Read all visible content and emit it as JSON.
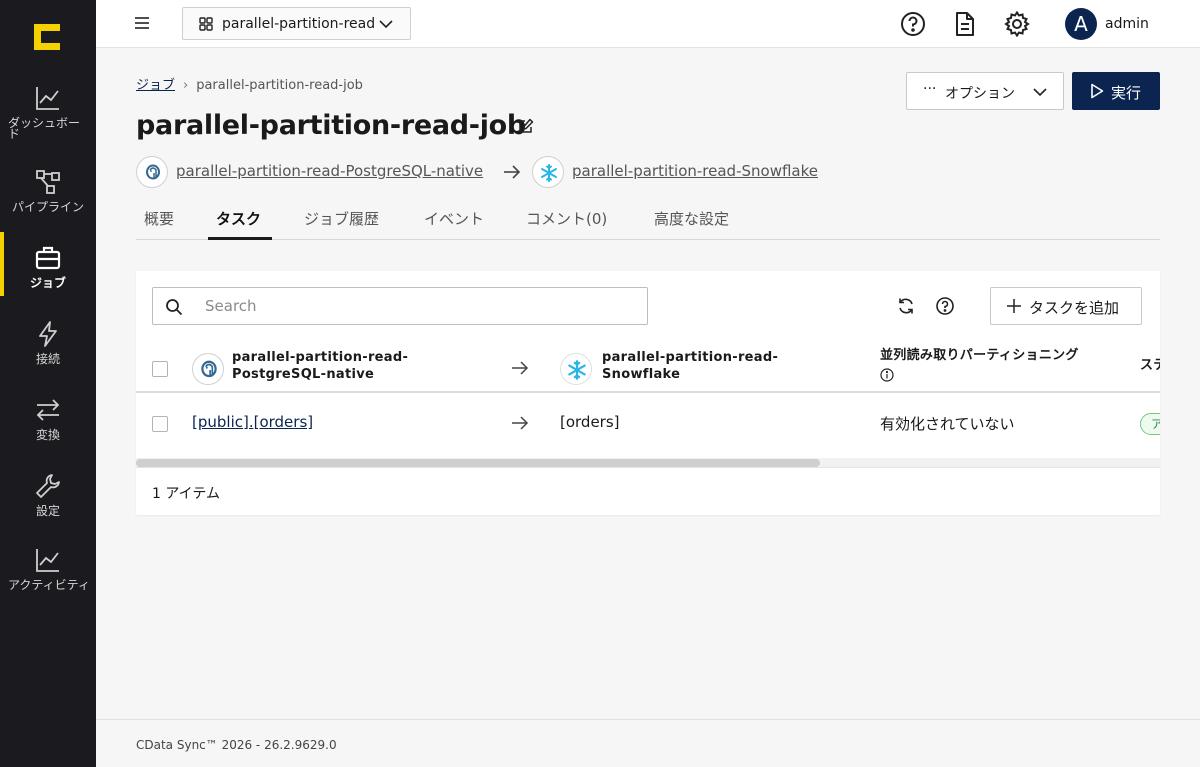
{
  "sidebar": {
    "items": [
      {
        "label": "ダッシュボード",
        "icon": "chart-line-icon"
      },
      {
        "label": "パイプライン",
        "icon": "pipeline-icon"
      },
      {
        "label": "ジョブ",
        "icon": "briefcase-icon"
      },
      {
        "label": "接続",
        "icon": "lightning-icon"
      },
      {
        "label": "変換",
        "icon": "transform-arrows-icon"
      },
      {
        "label": "設定",
        "icon": "wrench-icon"
      },
      {
        "label": "アクティビティ",
        "icon": "activity-chart-icon"
      }
    ],
    "active": "ジョブ"
  },
  "topbar": {
    "workspace": "parallel-partition-read",
    "user": "admin",
    "avatar_letter": "A"
  },
  "breadcrumb": {
    "parent": "ジョブ",
    "current": "parallel-partition-read-job"
  },
  "header": {
    "title": "parallel-partition-read-job",
    "options_label": "オプション",
    "run_label": "実行",
    "source": "parallel-partition-read-PostgreSQL-native",
    "destination": "parallel-partition-read-Snowflake"
  },
  "tabs": [
    "概要",
    "タスク",
    "ジョブ履歴",
    "イベント",
    "コメント(0)",
    "高度な設定"
  ],
  "active_tab": "タスク",
  "tasks": {
    "search_placeholder": "Search",
    "add_label": "タスクを追加",
    "columns": {
      "source": "parallel-partition-read-PostgreSQL-native",
      "destination": "parallel-partition-read-Snowflake",
      "partition": "並列読み取りパーティショニング",
      "status_partial": "ステ"
    },
    "rows": [
      {
        "source": "[public].[orders]",
        "destination": "[orders]",
        "partition": "有効化されていない",
        "status_partial": "ア"
      }
    ],
    "count_label": "1 アイテム"
  },
  "footer": {
    "version": "CData Sync™ 2026 - 26.2.9629.0"
  },
  "colors": {
    "sidebar_bg": "#1b1b1f",
    "accent_yellow": "#f5d100",
    "primary_navy": "#0b2550"
  }
}
